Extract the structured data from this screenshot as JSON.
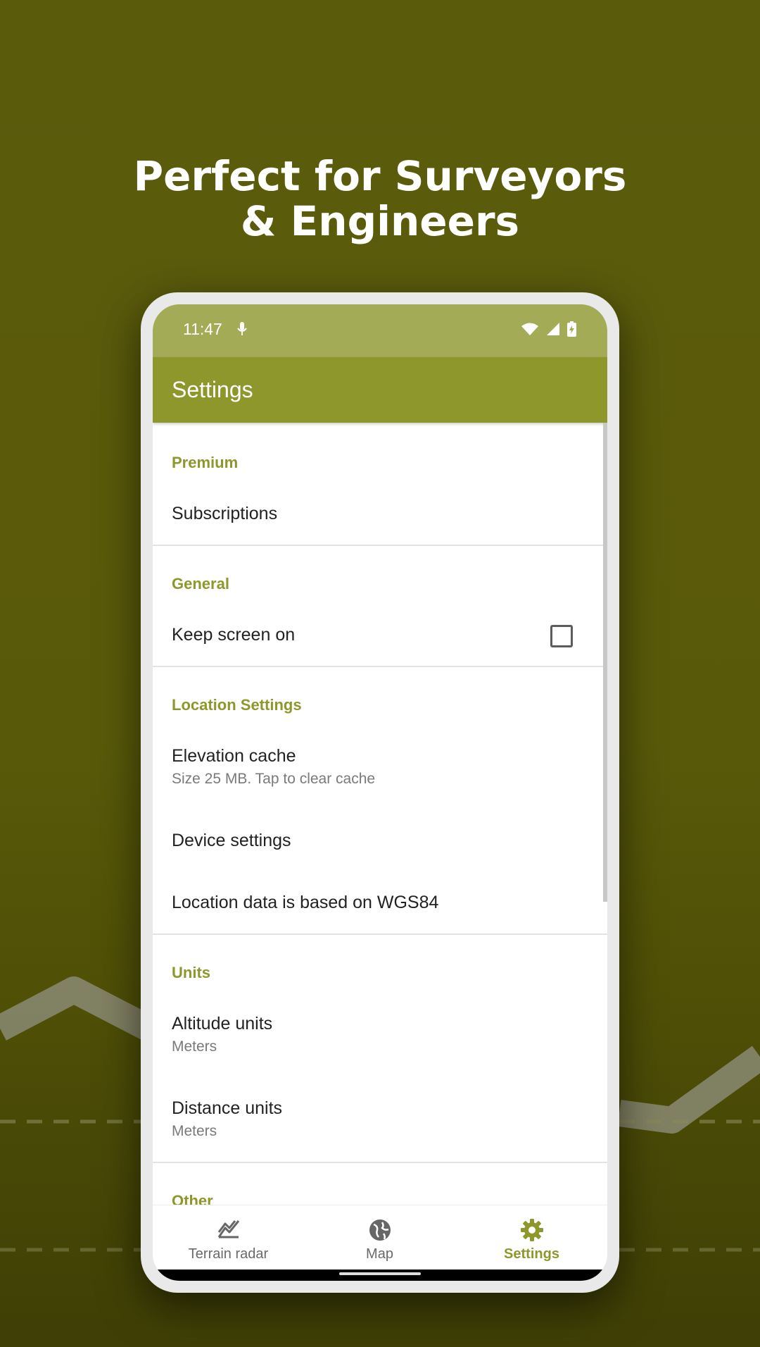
{
  "promo": {
    "line1": "Perfect for Surveyors",
    "line2": "& Engineers"
  },
  "status_bar": {
    "time": "11:47",
    "icons": [
      "mic-icon",
      "wifi-icon",
      "signal-icon",
      "battery-charging-icon"
    ]
  },
  "app_bar": {
    "title": "Settings"
  },
  "sections": {
    "premium": {
      "header": "Premium",
      "subscriptions": "Subscriptions"
    },
    "general": {
      "header": "General",
      "keep_screen_on": "Keep screen on",
      "keep_screen_on_checked": false
    },
    "location": {
      "header": "Location Settings",
      "elevation_cache": "Elevation cache",
      "elevation_cache_sub": "Size 25 MB. Tap to clear cache",
      "device_settings": "Device settings",
      "wgs84": "Location data is based on WGS84"
    },
    "units": {
      "header": "Units",
      "altitude": "Altitude units",
      "altitude_value": "Meters",
      "distance": "Distance units",
      "distance_value": "Meters"
    },
    "other": {
      "header": "Other"
    }
  },
  "bottom_nav": {
    "terrain_radar": "Terrain radar",
    "map": "Map",
    "settings": "Settings",
    "active": "settings"
  },
  "colors": {
    "accent": "#8e972b",
    "status_bar": "#a3ab57",
    "background": "#5b5b0c"
  }
}
